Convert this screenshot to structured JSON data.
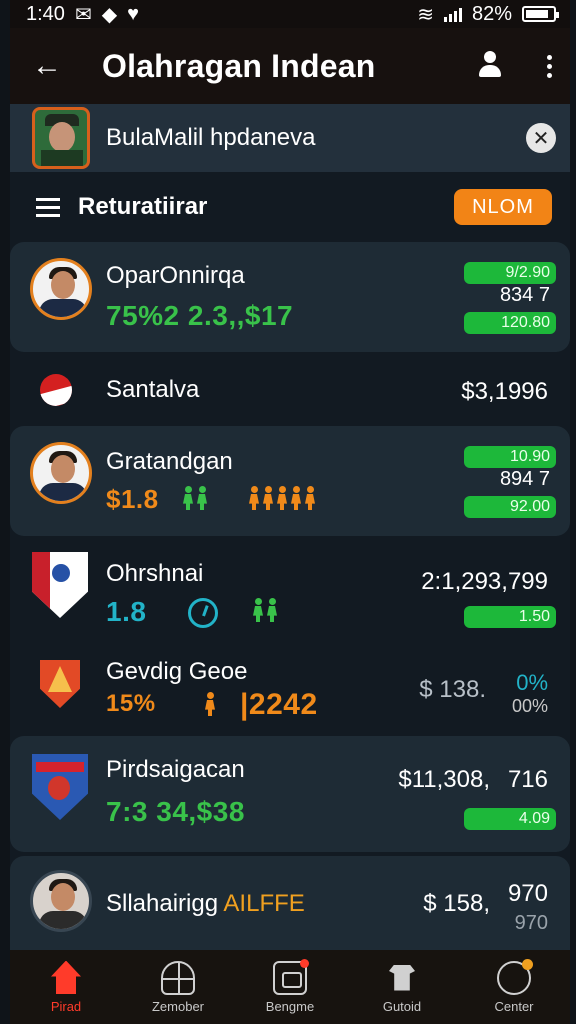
{
  "status_bar": {
    "time": "1:40",
    "battery": "82%"
  },
  "app_bar": {
    "title": "Olahragan Indean"
  },
  "search": {
    "value": "BulaMalil hpdaneva"
  },
  "filter": {
    "label": "Returatiirar",
    "button_label": "NLOM"
  },
  "rows": [
    {
      "name": "OparOnnirqa",
      "stat": "75%2  2.3,,$17",
      "pill_top": "9/2.90",
      "mid_value": "834  7",
      "pill_bottom": "120.80"
    },
    {
      "name": "Santalva",
      "price": "$3,1996"
    },
    {
      "name": "Gratandgan",
      "stat": "$1.8",
      "pill_top": "10.90",
      "mid_value": "894  7",
      "pill_bottom": "92.00"
    },
    {
      "name": "Ohrshnai",
      "stat": "1.8",
      "price": "2:1,293,799",
      "pill_bottom": "1.50"
    },
    {
      "name": "Gevdig Geoe",
      "stat_a": "15%",
      "stat_b": "2242",
      "price": "$ 138.",
      "pct_a": "0%",
      "pct_b": "00%"
    },
    {
      "name": "Pirdsaigacan",
      "stat": "7:3 34,$38",
      "price": "$11,308,",
      "price_accent": "716",
      "pill_bottom": "4.09"
    },
    {
      "name": "Sllahairigg",
      "name_accent": "AILFFE",
      "price": "$ 158,",
      "price_accent": "970",
      "sub_value": "970"
    }
  ],
  "bottom_nav": [
    {
      "label": "Pirad"
    },
    {
      "label": "Zemober"
    },
    {
      "label": "Bengme"
    },
    {
      "label": "Gutoid"
    },
    {
      "label": "Center"
    }
  ],
  "colors": {
    "accent_orange": "#f28416",
    "accent_green": "#1db83a",
    "background": "#121a22",
    "card": "#1e2b35"
  }
}
